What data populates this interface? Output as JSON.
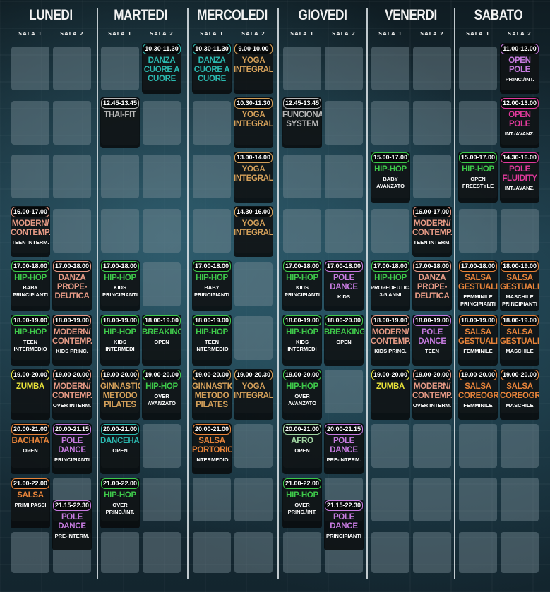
{
  "days": [
    "LUNEDI",
    "MARTEDI",
    "MERCOLEDI",
    "GIOVEDI",
    "VENERDI",
    "SABATO"
  ],
  "rooms": [
    "SALA 1",
    "SALA 2"
  ],
  "colors": {
    "green": "#3ec94a",
    "teal": "#2bb9b0",
    "orange": "#e8843a",
    "tan": "#d4a05a",
    "salmon": "#e69a85",
    "purple": "#c77be0",
    "pink": "#e23a9c",
    "gray": "#b7b7b7",
    "yellow": "#e8e23a",
    "paleGreen": "#9fd4a0"
  },
  "classes": [
    {
      "day": 0,
      "room": 0,
      "row": 3,
      "time": "16.00-17.00",
      "title": "MODERN/\nCONTEMP.",
      "sub": "TEEN INTERM.",
      "color": "salmon"
    },
    {
      "day": 0,
      "room": 0,
      "row": 4,
      "time": "17.00-18.00",
      "title": "HIP-HOP",
      "sub": "BABY\nPRINCIPIANTI",
      "color": "green"
    },
    {
      "day": 0,
      "room": 1,
      "row": 4,
      "time": "17.00-18.00",
      "title": "DANZA\nPROPE-\nDEUTICA",
      "sub": "",
      "color": "salmon"
    },
    {
      "day": 0,
      "room": 0,
      "row": 5,
      "time": "18.00-19.00",
      "title": "HIP-HOP",
      "sub": "TEEN\nINTERMEDIO",
      "color": "green"
    },
    {
      "day": 0,
      "room": 1,
      "row": 5,
      "time": "18.00-19.00",
      "title": "MODERN/\nCONTEMP.",
      "sub": "KIDS PRINC.",
      "color": "salmon"
    },
    {
      "day": 0,
      "room": 0,
      "row": 6,
      "time": "19.00-20.00",
      "title": "ZUMBA",
      "sub": "",
      "color": "yellow"
    },
    {
      "day": 0,
      "room": 1,
      "row": 6,
      "time": "19.00-20.00",
      "title": "MODERN/\nCONTEMP.",
      "sub": "OVER INTERM.",
      "color": "salmon"
    },
    {
      "day": 0,
      "room": 0,
      "row": 7,
      "time": "20.00-21.00",
      "title": "BACHATA",
      "sub": "OPEN",
      "color": "orange"
    },
    {
      "day": 0,
      "room": 1,
      "row": 7,
      "time": "20.00-21.15",
      "title": "POLE\nDANCE",
      "sub": "PRINCIPIANTI",
      "color": "purple"
    },
    {
      "day": 0,
      "room": 0,
      "row": 8,
      "time": "21.00-22.00",
      "title": "SALSA",
      "sub": "PRIMI PASSI",
      "color": "orange"
    },
    {
      "day": 0,
      "room": 1,
      "row": 8.4,
      "time": "21.15-22.30",
      "title": "POLE\nDANCE",
      "sub": "PRE-INTERM.",
      "color": "purple"
    },
    {
      "day": 1,
      "room": 1,
      "row": 0,
      "time": "10.30-11.30",
      "title": "DANZA\nCUORE A\nCUORE",
      "sub": "",
      "color": "teal"
    },
    {
      "day": 1,
      "room": 0,
      "row": 1,
      "time": "12.45-13.45",
      "title": "THAI-FIT",
      "sub": "",
      "color": "gray"
    },
    {
      "day": 1,
      "room": 0,
      "row": 4,
      "time": "17.00-18.00",
      "title": "HIP-HOP",
      "sub": "KIDS\nPRINCIPIANTI",
      "color": "green"
    },
    {
      "day": 1,
      "room": 0,
      "row": 5,
      "time": "18.00-19.00",
      "title": "HIP-HOP",
      "sub": "KIDS\nINTERMEDI",
      "color": "green"
    },
    {
      "day": 1,
      "room": 1,
      "row": 5,
      "time": "18.00-19.00",
      "title": "BREAKING",
      "sub": "OPEN",
      "color": "green"
    },
    {
      "day": 1,
      "room": 0,
      "row": 6,
      "time": "19.00-20.00",
      "title": "GINNASTICA\nMETODO\nPILATES",
      "sub": "",
      "color": "tan"
    },
    {
      "day": 1,
      "room": 1,
      "row": 6,
      "time": "19.00-20.00",
      "title": "HIP-HOP",
      "sub": "OVER\nAVANZATO",
      "color": "green"
    },
    {
      "day": 1,
      "room": 0,
      "row": 7,
      "time": "20.00-21.00",
      "title": "DANCEHALL",
      "sub": "OPEN",
      "color": "teal"
    },
    {
      "day": 1,
      "room": 0,
      "row": 8,
      "time": "21.00-22.00",
      "title": "HIP-HOP",
      "sub": "OVER\nPRINC./INT.",
      "color": "green"
    },
    {
      "day": 2,
      "room": 0,
      "row": 0,
      "time": "10.30-11.30",
      "title": "DANZA\nCUORE A\nCUORE",
      "sub": "",
      "color": "teal"
    },
    {
      "day": 2,
      "room": 1,
      "row": 0,
      "time": "9.00-10.00",
      "title": "YOGA\nINTEGRALE",
      "sub": "",
      "color": "tan"
    },
    {
      "day": 2,
      "room": 1,
      "row": 1,
      "time": "10.30-11.30",
      "title": "YOGA\nINTEGRALE",
      "sub": "",
      "color": "tan"
    },
    {
      "day": 2,
      "room": 1,
      "row": 2,
      "time": "13.00-14.00",
      "title": "YOGA\nINTEGRALE",
      "sub": "",
      "color": "tan"
    },
    {
      "day": 2,
      "room": 1,
      "row": 3,
      "time": "14.30-16.00",
      "title": "YOGA\nINTEGRALE",
      "sub": "",
      "color": "tan"
    },
    {
      "day": 2,
      "room": 0,
      "row": 4,
      "time": "17.00-18.00",
      "title": "HIP-HOP",
      "sub": "BABY\nPRINCIPIANTI",
      "color": "green"
    },
    {
      "day": 2,
      "room": 0,
      "row": 5,
      "time": "18.00-19.00",
      "title": "HIP-HOP",
      "sub": "TEEN\nINTERMEDIO",
      "color": "green"
    },
    {
      "day": 2,
      "room": 0,
      "row": 6,
      "time": "19.00-20.00",
      "title": "GINNASTICA\nMETODO\nPILATES",
      "sub": "",
      "color": "tan"
    },
    {
      "day": 2,
      "room": 1,
      "row": 6,
      "time": "19.00-20.30",
      "title": "YOGA\nINTEGRALE",
      "sub": "",
      "color": "tan"
    },
    {
      "day": 2,
      "room": 0,
      "row": 7,
      "time": "20.00-21.00",
      "title": "SALSA\nPORTORIC.",
      "sub": "INTERMEDIO",
      "color": "orange"
    },
    {
      "day": 3,
      "room": 0,
      "row": 1,
      "time": "12.45-13.45",
      "title": "FUNCIONAL\nSYSTEM",
      "sub": "",
      "color": "gray"
    },
    {
      "day": 3,
      "room": 0,
      "row": 4,
      "time": "17.00-18.00",
      "title": "HIP-HOP",
      "sub": "KIDS\nPRINCIPIANTI",
      "color": "green"
    },
    {
      "day": 3,
      "room": 1,
      "row": 4,
      "time": "17.00-18.00",
      "title": "POLE\nDANCE",
      "sub": "KIDS",
      "color": "purple"
    },
    {
      "day": 3,
      "room": 0,
      "row": 5,
      "time": "18.00-19.00",
      "title": "HIP-HOP",
      "sub": "KIDS\nINTERMEDI",
      "color": "green"
    },
    {
      "day": 3,
      "room": 1,
      "row": 5,
      "time": "18.00-20.00",
      "title": "BREAKING",
      "sub": "OPEN",
      "color": "green"
    },
    {
      "day": 3,
      "room": 0,
      "row": 6,
      "time": "19.00-20.00",
      "title": "HIP-HOP",
      "sub": "OVER\nAVANZATO",
      "color": "green"
    },
    {
      "day": 3,
      "room": 0,
      "row": 7,
      "time": "20.00-21.00",
      "title": "AFRO",
      "sub": "OPEN",
      "color": "paleGreen"
    },
    {
      "day": 3,
      "room": 1,
      "row": 7,
      "time": "20.00-21.15",
      "title": "POLE\nDANCE",
      "sub": "PRE-INTERM.",
      "color": "purple"
    },
    {
      "day": 3,
      "room": 0,
      "row": 8,
      "time": "21.00-22.00",
      "title": "HIP-HOP",
      "sub": "OVER\nPRINC./INT.",
      "color": "green"
    },
    {
      "day": 3,
      "room": 1,
      "row": 8.4,
      "time": "21.15-22.30",
      "title": "POLE\nDANCE",
      "sub": "PRINCIPIANTI",
      "color": "purple"
    },
    {
      "day": 4,
      "room": 0,
      "row": 2,
      "time": "15.00-17.00",
      "title": "HIP-HOP",
      "sub": "BABY\nAVANZATO",
      "color": "green"
    },
    {
      "day": 4,
      "room": 1,
      "row": 3,
      "time": "16.00-17.00",
      "title": "MODERN/\nCONTEMP.",
      "sub": "TEEN INTERM.",
      "color": "salmon"
    },
    {
      "day": 4,
      "room": 0,
      "row": 4,
      "time": "17.00-18.00",
      "title": "HIP-HOP",
      "sub": "PROPEDEUTIC.\n3-5 ANNI",
      "color": "green"
    },
    {
      "day": 4,
      "room": 1,
      "row": 4,
      "time": "17.00-18.00",
      "title": "DANZA\nPROPE-\nDEUTICA",
      "sub": "",
      "color": "salmon"
    },
    {
      "day": 4,
      "room": 0,
      "row": 5,
      "time": "18.00-19.00",
      "title": "MODERN/\nCONTEMP.",
      "sub": "KIDS PRINC.",
      "color": "salmon"
    },
    {
      "day": 4,
      "room": 1,
      "row": 5,
      "time": "18.00-19.00",
      "title": "POLE\nDANCE",
      "sub": "TEEN",
      "color": "purple"
    },
    {
      "day": 4,
      "room": 0,
      "row": 6,
      "time": "19.00-20.00",
      "title": "ZUMBA",
      "sub": "",
      "color": "yellow"
    },
    {
      "day": 4,
      "room": 1,
      "row": 6,
      "time": "19.00-20.00",
      "title": "MODERN/\nCONTEMP.",
      "sub": "OVER INTERM.",
      "color": "salmon"
    },
    {
      "day": 5,
      "room": 1,
      "row": 0,
      "time": "11.00-12.00",
      "title": "OPEN POLE",
      "sub": "PRINC./INT.",
      "color": "purple"
    },
    {
      "day": 5,
      "room": 1,
      "row": 1,
      "time": "12.00-13.00",
      "title": "OPEN POLE",
      "sub": "INT./AVANZ.",
      "color": "pink"
    },
    {
      "day": 5,
      "room": 0,
      "row": 2,
      "time": "15.00-17.00",
      "title": "HIP-HOP",
      "sub": "OPEN\nFREESTYLE",
      "color": "green"
    },
    {
      "day": 5,
      "room": 1,
      "row": 2,
      "time": "14.30-16.00",
      "title": "POLE\nFLUIDITY",
      "sub": "INT./AVANZ.",
      "color": "pink"
    },
    {
      "day": 5,
      "room": 0,
      "row": 4,
      "time": "17.00-18.00",
      "title": "SALSA\nGESTUALITÀ",
      "sub": "FEMMINILE\nPRINCIPIANTI",
      "color": "orange"
    },
    {
      "day": 5,
      "room": 1,
      "row": 4,
      "time": "18.00-19.00",
      "title": "SALSA\nGESTUALITÀ",
      "sub": "MASCHILE\nPRINCIPIANTI",
      "color": "orange"
    },
    {
      "day": 5,
      "room": 0,
      "row": 5,
      "time": "18.00-19.00",
      "title": "SALSA\nGESTUALITÀ",
      "sub": "FEMMINILE",
      "color": "orange"
    },
    {
      "day": 5,
      "room": 1,
      "row": 5,
      "time": "18.00-19.00",
      "title": "SALSA\nGESTUALITÀ",
      "sub": "MASCHILE",
      "color": "orange"
    },
    {
      "day": 5,
      "room": 0,
      "row": 6,
      "time": "19.00-20.00",
      "title": "SALSA\nCOREOGR.",
      "sub": "FEMMINILE",
      "color": "orange"
    },
    {
      "day": 5,
      "room": 1,
      "row": 6,
      "time": "19.00-20.00",
      "title": "SALSA\nCOREOGR.",
      "sub": "MASCHILE",
      "color": "orange"
    }
  ]
}
